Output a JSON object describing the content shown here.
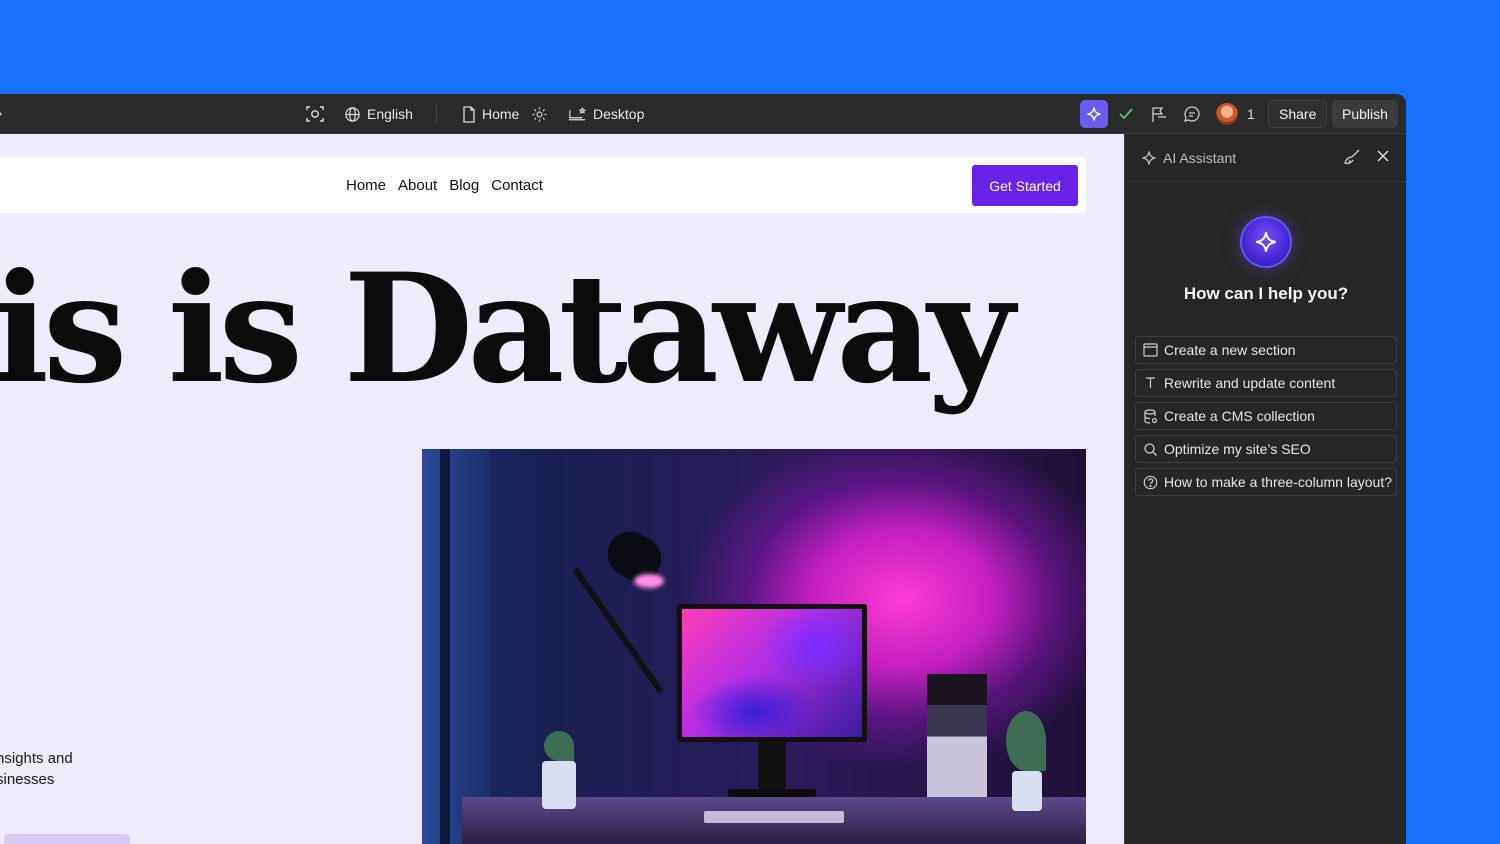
{
  "toolbar": {
    "language": "English",
    "page": "Home",
    "device": "Desktop",
    "collaborator_count": "1",
    "share_label": "Share",
    "publish_label": "Publish"
  },
  "site": {
    "nav": [
      "Home",
      "About",
      "Blog",
      "Contact"
    ],
    "cta_label": "Get Started",
    "hero_title": "is is Dataway",
    "hero_copy_line1": "nsights and",
    "hero_copy_line2": "sinesses"
  },
  "ai_panel": {
    "title": "AI Assistant",
    "question": "How can I help you?",
    "suggestions": [
      {
        "label": "Create a new section",
        "icon": "layout-icon"
      },
      {
        "label": "Rewrite and update content",
        "icon": "text-icon"
      },
      {
        "label": "Create a CMS collection",
        "icon": "database-icon"
      },
      {
        "label": "Optimize my site’s SEO",
        "icon": "search-icon"
      },
      {
        "label": "How to make a three-column layout?",
        "icon": "help-icon"
      }
    ]
  },
  "colors": {
    "background": "#1670FA",
    "canvas": "#EFEBFB",
    "cta": "#6A22E8",
    "ai_button": "#6A5CF0",
    "panel": "#262626"
  }
}
